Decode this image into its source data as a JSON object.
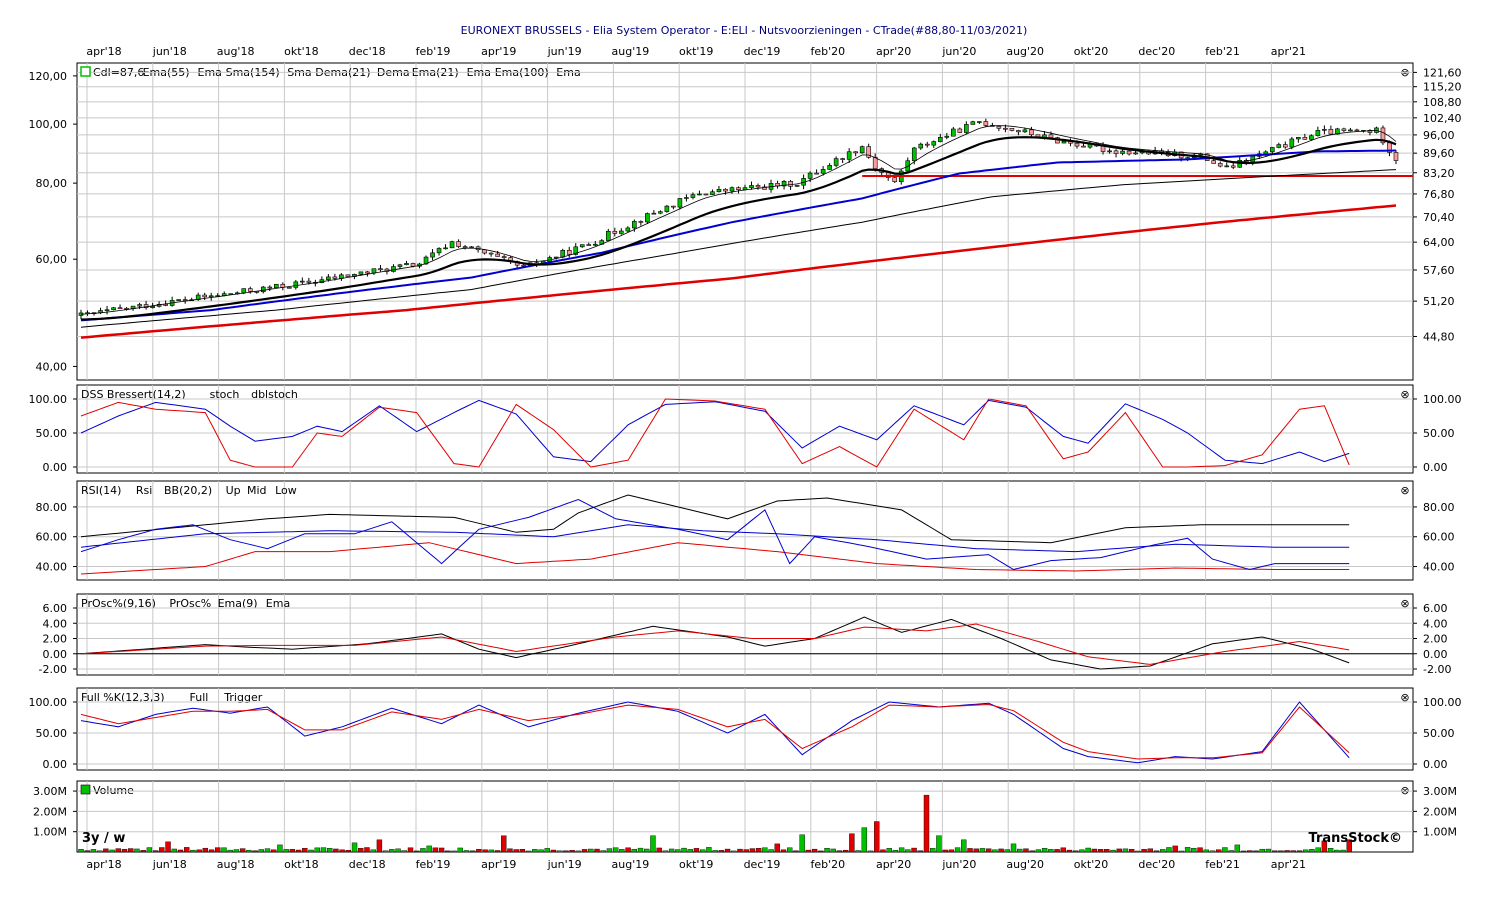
{
  "title": "EURONEXT BRUSSELS - Elia System Operator - E:ELI - Nutsvoorzieningen - CTrade(#88,80-11/03/2021)",
  "period_label": "3y / w",
  "watermark": "TransStock©",
  "close_glyph": "⊗",
  "colors": {
    "green": "#00c000",
    "red": "#e00000",
    "blue": "#0000d0",
    "black": "#000000",
    "title": "#00007f",
    "grid": "#c8c8c8"
  },
  "months": [
    "apr'18",
    "jun'18",
    "aug'18",
    "okt'18",
    "dec'18",
    "feb'19",
    "apr'19",
    "jun'19",
    "aug'19",
    "okt'19",
    "dec'19",
    "feb'20",
    "apr'20",
    "jun'20",
    "aug'20",
    "okt'20",
    "dec'20",
    "feb'21",
    "apr'21"
  ],
  "panels": [
    {
      "id": "price",
      "type": "candlestick",
      "legend": [
        "Cdl=87,6",
        "Ema(55)",
        "Ema",
        "Sma(154)",
        "Sma",
        "Dema(21)",
        "Dema",
        "Ema(21)",
        "Ema",
        "Ema(100)",
        "Ema"
      ],
      "left_ticks": [
        "120,00",
        "100,00",
        "80,00",
        "60,00",
        "40,00"
      ],
      "right_ticks": [
        "121,60",
        "115,20",
        "108,80",
        "102,40",
        "96,00",
        "89,60",
        "83,20",
        "76,80",
        "70,40",
        "64,00",
        "57,60",
        "51,20",
        "44,80"
      ]
    },
    {
      "id": "dss",
      "legend": [
        "DSS Bressert(14,2)",
        "stoch",
        "dblstoch"
      ],
      "left_ticks": [
        "100.00",
        "50.00",
        "0.00"
      ],
      "right_ticks": [
        "100.00",
        "50.00",
        "0.00"
      ]
    },
    {
      "id": "rsi",
      "legend": [
        "RSI(14)",
        "Rsi",
        "BB(20,2)",
        "Up",
        "Mid",
        "Low"
      ],
      "left_ticks": [
        "80.00",
        "60.00",
        "40.00"
      ],
      "right_ticks": [
        "80.00",
        "60.00",
        "40.00"
      ]
    },
    {
      "id": "prosc",
      "legend": [
        "PrOsc%(9,16)",
        "PrOsc%",
        "Ema(9)",
        "Ema"
      ],
      "left_ticks": [
        "6.00",
        "4.00",
        "2.00",
        "0.00",
        "-2.00"
      ],
      "right_ticks": [
        "6.00",
        "4.00",
        "2.00",
        "0.00",
        "-2.00"
      ]
    },
    {
      "id": "fullk",
      "legend": [
        "Full %K(12,3,3)",
        "Full",
        "Trigger"
      ],
      "left_ticks": [
        "100.00",
        "50.00",
        "0.00"
      ],
      "right_ticks": [
        "100.00",
        "50.00",
        "0.00"
      ]
    },
    {
      "id": "volume",
      "legend": [
        "Volume"
      ],
      "left_ticks": [
        "3.00M",
        "2.00M",
        "1.00M"
      ],
      "right_ticks": [
        "3.00M",
        "2.00M",
        "1.00M"
      ]
    }
  ],
  "chart_data": {
    "type": "candlestick",
    "x_unit": "week index (0 = week of 19/03/2018, 1 per week; 156 weeks, last = 11/03/2021)",
    "price_log_scale": true,
    "price_ylim": [
      38,
      126
    ],
    "price_knots": [
      [
        0,
        48.5
      ],
      [
        12,
        50.8
      ],
      [
        22,
        52.5
      ],
      [
        35,
        55
      ],
      [
        52,
        59
      ],
      [
        57,
        64
      ],
      [
        68,
        58
      ],
      [
        78,
        63.5
      ],
      [
        95,
        77
      ],
      [
        110,
        80
      ],
      [
        120,
        92
      ],
      [
        122,
        85
      ],
      [
        125,
        80
      ],
      [
        128,
        91
      ],
      [
        138,
        101
      ],
      [
        150,
        94
      ],
      [
        158,
        90.5
      ],
      [
        172,
        88.5
      ],
      [
        176,
        84.5
      ],
      [
        190,
        97
      ],
      [
        199,
        97.5
      ],
      [
        202,
        87.6
      ]
    ],
    "horizontal_level": 82.2,
    "ema55_knots": [
      [
        0,
        47.6
      ],
      [
        20,
        49.5
      ],
      [
        40,
        52.8
      ],
      [
        60,
        56
      ],
      [
        80,
        61.5
      ],
      [
        100,
        69
      ],
      [
        120,
        75.5
      ],
      [
        135,
        83
      ],
      [
        150,
        86.5
      ],
      [
        170,
        87.5
      ],
      [
        190,
        90.2
      ],
      [
        202,
        90.5
      ]
    ],
    "ema100_knots": [
      [
        0,
        46.4
      ],
      [
        30,
        49.5
      ],
      [
        60,
        53.5
      ],
      [
        90,
        61
      ],
      [
        120,
        69
      ],
      [
        140,
        76
      ],
      [
        160,
        79.5
      ],
      [
        180,
        81.8
      ],
      [
        202,
        84.2
      ]
    ],
    "sma154_knots": [
      [
        0,
        44.6
      ],
      [
        50,
        49.5
      ],
      [
        100,
        55.8
      ],
      [
        140,
        62.8
      ],
      [
        175,
        69
      ],
      [
        202,
        73.5
      ]
    ],
    "dss_knots": {
      "stoch": [
        [
          0,
          50
        ],
        [
          6,
          75
        ],
        [
          12,
          95
        ],
        [
          20,
          85
        ],
        [
          24,
          60
        ],
        [
          28,
          38
        ],
        [
          34,
          45
        ],
        [
          38,
          60
        ],
        [
          42,
          52
        ],
        [
          48,
          90
        ],
        [
          54,
          52
        ],
        [
          60,
          80
        ],
        [
          64,
          98
        ],
        [
          70,
          78
        ],
        [
          76,
          15
        ],
        [
          82,
          8
        ],
        [
          88,
          62
        ],
        [
          94,
          92
        ],
        [
          102,
          96
        ],
        [
          110,
          82
        ],
        [
          116,
          28
        ],
        [
          122,
          60
        ],
        [
          128,
          40
        ],
        [
          134,
          90
        ],
        [
          142,
          62
        ],
        [
          146,
          98
        ],
        [
          152,
          88
        ],
        [
          158,
          45
        ],
        [
          162,
          35
        ],
        [
          168,
          93
        ],
        [
          174,
          70
        ],
        [
          178,
          50
        ],
        [
          184,
          10
        ],
        [
          190,
          5
        ],
        [
          196,
          22
        ],
        [
          200,
          8
        ],
        [
          204,
          20
        ]
      ],
      "dbl": [
        [
          0,
          75
        ],
        [
          6,
          95
        ],
        [
          12,
          85
        ],
        [
          20,
          80
        ],
        [
          24,
          10
        ],
        [
          28,
          0
        ],
        [
          34,
          0
        ],
        [
          38,
          50
        ],
        [
          42,
          45
        ],
        [
          48,
          88
        ],
        [
          54,
          80
        ],
        [
          60,
          5
        ],
        [
          64,
          0
        ],
        [
          70,
          92
        ],
        [
          76,
          55
        ],
        [
          82,
          0
        ],
        [
          88,
          10
        ],
        [
          94,
          100
        ],
        [
          102,
          97
        ],
        [
          110,
          85
        ],
        [
          116,
          5
        ],
        [
          122,
          30
        ],
        [
          128,
          0
        ],
        [
          134,
          85
        ],
        [
          142,
          40
        ],
        [
          146,
          100
        ],
        [
          152,
          90
        ],
        [
          158,
          12
        ],
        [
          162,
          22
        ],
        [
          168,
          80
        ],
        [
          174,
          0
        ],
        [
          178,
          0
        ],
        [
          184,
          2
        ],
        [
          190,
          18
        ],
        [
          196,
          85
        ],
        [
          200,
          90
        ],
        [
          204,
          3
        ]
      ]
    },
    "rsi_knots": {
      "rsi": [
        [
          0,
          50
        ],
        [
          6,
          58
        ],
        [
          12,
          65
        ],
        [
          18,
          68
        ],
        [
          24,
          58
        ],
        [
          30,
          52
        ],
        [
          36,
          62
        ],
        [
          44,
          62
        ],
        [
          50,
          70
        ],
        [
          58,
          42
        ],
        [
          64,
          65
        ],
        [
          72,
          73
        ],
        [
          80,
          85
        ],
        [
          86,
          72
        ],
        [
          96,
          65
        ],
        [
          104,
          58
        ],
        [
          110,
          78
        ],
        [
          114,
          42
        ],
        [
          118,
          60
        ],
        [
          126,
          54
        ],
        [
          136,
          45
        ],
        [
          146,
          48
        ],
        [
          150,
          38
        ],
        [
          156,
          44
        ],
        [
          164,
          46
        ],
        [
          172,
          54
        ],
        [
          178,
          59
        ],
        [
          182,
          45
        ],
        [
          188,
          38
        ],
        [
          192,
          42
        ]
      ],
      "up": [
        [
          0,
          60
        ],
        [
          10,
          64
        ],
        [
          30,
          72
        ],
        [
          40,
          75
        ],
        [
          50,
          74
        ],
        [
          60,
          73
        ],
        [
          70,
          63
        ],
        [
          76,
          65
        ],
        [
          80,
          76
        ],
        [
          88,
          88
        ],
        [
          96,
          80
        ],
        [
          104,
          72
        ],
        [
          112,
          84
        ],
        [
          120,
          86
        ],
        [
          132,
          78
        ],
        [
          140,
          58
        ],
        [
          156,
          56
        ],
        [
          168,
          66
        ],
        [
          180,
          68
        ],
        [
          192,
          68
        ]
      ],
      "mid": [
        [
          0,
          53
        ],
        [
          20,
          62
        ],
        [
          40,
          64
        ],
        [
          60,
          63
        ],
        [
          76,
          60
        ],
        [
          88,
          68
        ],
        [
          100,
          64
        ],
        [
          112,
          62
        ],
        [
          128,
          58
        ],
        [
          144,
          52
        ],
        [
          160,
          50
        ],
        [
          176,
          55
        ],
        [
          192,
          53
        ]
      ],
      "low": [
        [
          0,
          35
        ],
        [
          20,
          40
        ],
        [
          28,
          50
        ],
        [
          40,
          50
        ],
        [
          56,
          56
        ],
        [
          70,
          42
        ],
        [
          82,
          45
        ],
        [
          96,
          56
        ],
        [
          112,
          50
        ],
        [
          128,
          42
        ],
        [
          144,
          38
        ],
        [
          160,
          37
        ],
        [
          176,
          39
        ],
        [
          192,
          38
        ]
      ]
    },
    "prosc_knots": {
      "prosc": [
        [
          0,
          0
        ],
        [
          20,
          1.2
        ],
        [
          26,
          0.9
        ],
        [
          34,
          0.6
        ],
        [
          46,
          1.3
        ],
        [
          58,
          2.6
        ],
        [
          64,
          0.6
        ],
        [
          70,
          -0.5
        ],
        [
          80,
          1.3
        ],
        [
          92,
          3.6
        ],
        [
          104,
          2.2
        ],
        [
          110,
          1.0
        ],
        [
          118,
          2.0
        ],
        [
          126,
          4.8
        ],
        [
          132,
          2.8
        ],
        [
          140,
          4.5
        ],
        [
          148,
          2.0
        ],
        [
          156,
          -0.8
        ],
        [
          164,
          -2.0
        ],
        [
          172,
          -1.6
        ],
        [
          182,
          1.3
        ],
        [
          190,
          2.2
        ],
        [
          198,
          0.6
        ],
        [
          204,
          -1.2
        ]
      ],
      "ema": [
        [
          0,
          0
        ],
        [
          20,
          1.0
        ],
        [
          30,
          1.1
        ],
        [
          44,
          1.1
        ],
        [
          58,
          2.2
        ],
        [
          70,
          0.3
        ],
        [
          86,
          2.2
        ],
        [
          96,
          3.0
        ],
        [
          108,
          2.0
        ],
        [
          118,
          2.0
        ],
        [
          126,
          3.5
        ],
        [
          136,
          3.0
        ],
        [
          144,
          3.9
        ],
        [
          154,
          1.6
        ],
        [
          162,
          -0.4
        ],
        [
          172,
          -1.4
        ],
        [
          184,
          0.3
        ],
        [
          196,
          1.6
        ],
        [
          204,
          0.5
        ]
      ]
    },
    "fullk_knots": {
      "full": [
        [
          0,
          70
        ],
        [
          6,
          60
        ],
        [
          12,
          80
        ],
        [
          18,
          90
        ],
        [
          24,
          82
        ],
        [
          30,
          92
        ],
        [
          36,
          45
        ],
        [
          42,
          60
        ],
        [
          50,
          90
        ],
        [
          58,
          65
        ],
        [
          64,
          95
        ],
        [
          72,
          60
        ],
        [
          80,
          82
        ],
        [
          88,
          100
        ],
        [
          96,
          85
        ],
        [
          104,
          50
        ],
        [
          110,
          80
        ],
        [
          116,
          15
        ],
        [
          124,
          70
        ],
        [
          130,
          100
        ],
        [
          138,
          92
        ],
        [
          146,
          98
        ],
        [
          150,
          80
        ],
        [
          158,
          25
        ],
        [
          162,
          12
        ],
        [
          170,
          2
        ],
        [
          176,
          12
        ],
        [
          182,
          8
        ],
        [
          190,
          20
        ],
        [
          196,
          100
        ],
        [
          204,
          10
        ]
      ],
      "trigger": [
        [
          0,
          80
        ],
        [
          6,
          65
        ],
        [
          12,
          75
        ],
        [
          18,
          85
        ],
        [
          24,
          85
        ],
        [
          30,
          88
        ],
        [
          36,
          55
        ],
        [
          42,
          55
        ],
        [
          50,
          84
        ],
        [
          58,
          72
        ],
        [
          64,
          88
        ],
        [
          72,
          70
        ],
        [
          80,
          80
        ],
        [
          88,
          95
        ],
        [
          96,
          88
        ],
        [
          104,
          60
        ],
        [
          110,
          72
        ],
        [
          116,
          25
        ],
        [
          124,
          60
        ],
        [
          130,
          95
        ],
        [
          138,
          92
        ],
        [
          146,
          96
        ],
        [
          150,
          86
        ],
        [
          158,
          35
        ],
        [
          162,
          20
        ],
        [
          170,
          8
        ],
        [
          176,
          10
        ],
        [
          182,
          10
        ],
        [
          190,
          18
        ],
        [
          196,
          92
        ],
        [
          204,
          18
        ]
      ]
    },
    "volume_spikes_M": [
      [
        14,
        0.5
      ],
      [
        32,
        0.35
      ],
      [
        44,
        0.45
      ],
      [
        48,
        0.6
      ],
      [
        56,
        0.3
      ],
      [
        68,
        0.8
      ],
      [
        92,
        0.8
      ],
      [
        112,
        0.4
      ],
      [
        116,
        0.85
      ],
      [
        124,
        0.9
      ],
      [
        126,
        1.2
      ],
      [
        128,
        1.5
      ],
      [
        136,
        2.8
      ],
      [
        138,
        0.8
      ],
      [
        142,
        0.6
      ],
      [
        150,
        0.4
      ],
      [
        176,
        0.3
      ],
      [
        186,
        0.35
      ],
      [
        200,
        0.55
      ],
      [
        204,
        0.6
      ]
    ]
  }
}
